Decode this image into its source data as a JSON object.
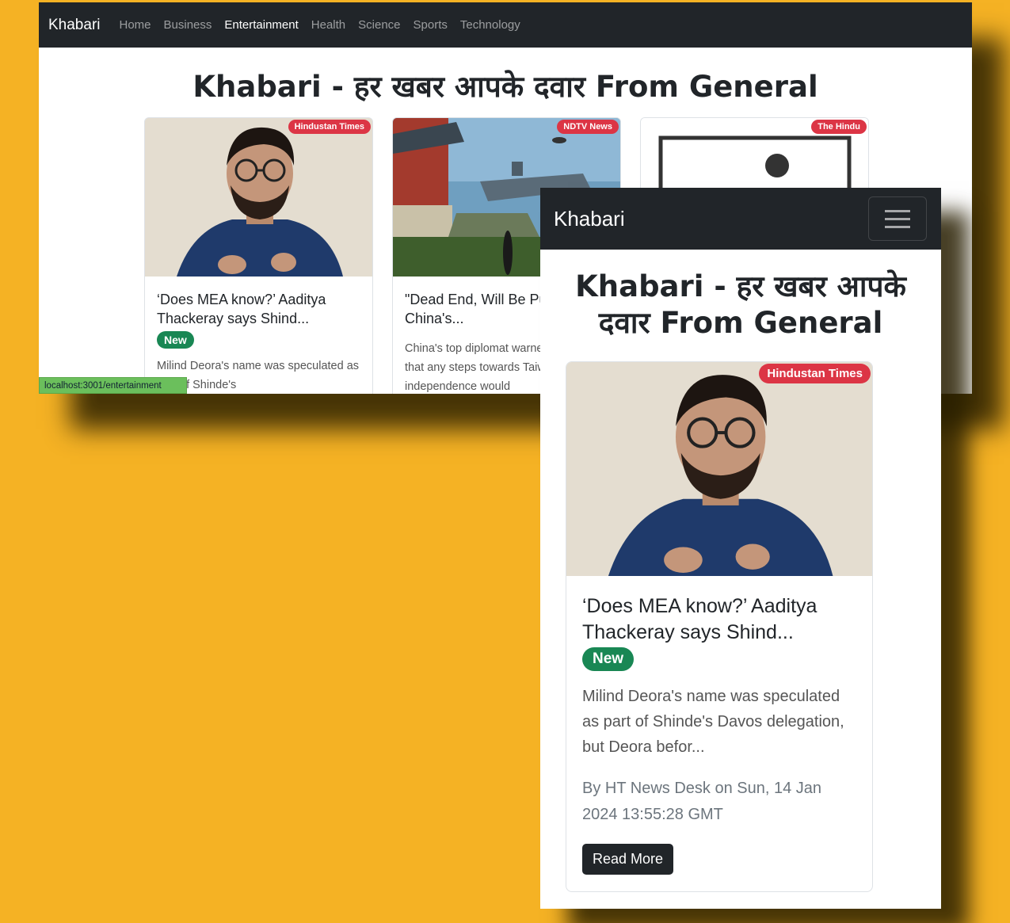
{
  "desktop": {
    "brand": "Khabari",
    "nav_links": [
      "Home",
      "Business",
      "Entertainment",
      "Health",
      "Science",
      "Sports",
      "Technology"
    ],
    "active_link_index": 2,
    "page_title": "Khabari - हर खबर आपके दवार From General",
    "status_url": "localhost:3001/entertainment",
    "cards": [
      {
        "source": "Hindustan Times",
        "title": "‘Does MEA know?’ Aaditya Thackeray says Shind...",
        "badge": "New",
        "description": "Milind Deora's name was speculated as part of Shinde's"
      },
      {
        "source": "NDTV News",
        "title": "\"Dead End, Will Be Punished\": China's...",
        "badge": "",
        "description": "China's top diplomat warned on Sunday that any steps towards Taiwan's independence would"
      },
      {
        "source": "The Hindu",
        "title": "",
        "badge": "",
        "description": ""
      }
    ]
  },
  "mobile": {
    "brand": "Khabari",
    "page_title": "Khabari - हर खबर आपके दवार From General",
    "card": {
      "source": "Hindustan Times",
      "title": "‘Does MEA know?’ Aaditya Thackeray says Shind...",
      "badge": "New",
      "description": "Milind Deora's name was speculated as part of Shinde's Davos delegation, but Deora befor...",
      "meta": "By HT News Desk on Sun, 14 Jan 2024 13:55:28 GMT",
      "button": "Read More"
    }
  },
  "colors": {
    "background": "#f5b224",
    "navbar": "#212529",
    "source_badge": "#dc3545",
    "new_badge": "#198754"
  }
}
